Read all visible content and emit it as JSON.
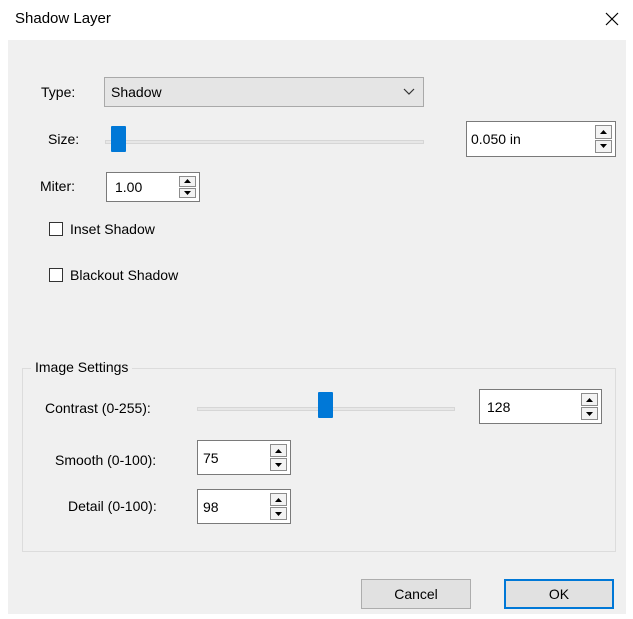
{
  "window": {
    "title": "Shadow Layer"
  },
  "type": {
    "label": "Type:",
    "value": "Shadow"
  },
  "size": {
    "label": "Size:",
    "value": "0.050 in"
  },
  "miter": {
    "label": "Miter:",
    "value": "1.00"
  },
  "inset_shadow": {
    "label": "Inset Shadow",
    "checked": false
  },
  "blackout_shadow": {
    "label": "Blackout Shadow",
    "checked": false
  },
  "image_settings": {
    "legend": "Image Settings",
    "contrast": {
      "label": "Contrast (0-255):",
      "value": "128"
    },
    "smooth": {
      "label": "Smooth (0-100):",
      "value": "75"
    },
    "detail": {
      "label": "Detail (0-100):",
      "value": "98"
    }
  },
  "buttons": {
    "cancel": "Cancel",
    "ok": "OK"
  },
  "colors": {
    "accent": "#0078d7",
    "dialog_bg": "#f0f0f0"
  }
}
